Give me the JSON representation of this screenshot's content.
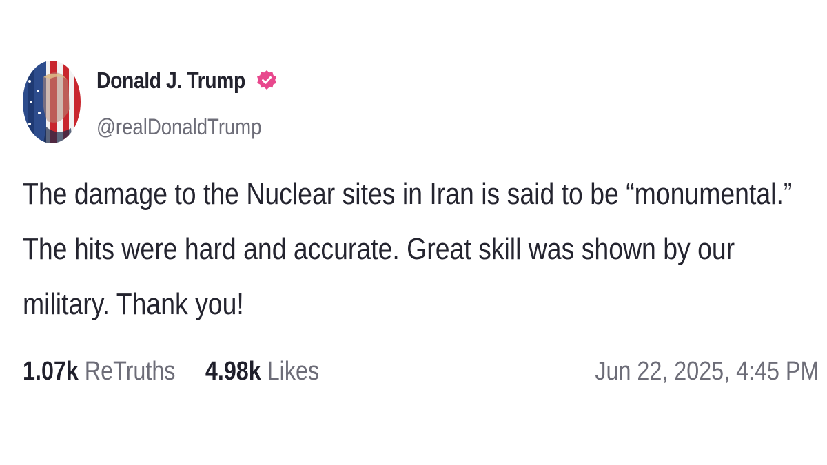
{
  "post": {
    "author_name": "Donald J. Trump",
    "author_handle": "@realDonaldTrump",
    "verified_icon": "verified-badge-icon",
    "verified_color": "#e8488d",
    "text_lines": [
      "The damage to the Nuclear sites in Iran is said to be “monumental.”",
      "The hits were hard and accurate. Great skill was shown by our",
      "military. Thank you!"
    ],
    "stats": {
      "retruths_count": "1.07k",
      "retruths_label": "ReTruths",
      "likes_count": "4.98k",
      "likes_label": "Likes"
    },
    "timestamp": "Jun 22, 2025, 4:45 PM"
  }
}
